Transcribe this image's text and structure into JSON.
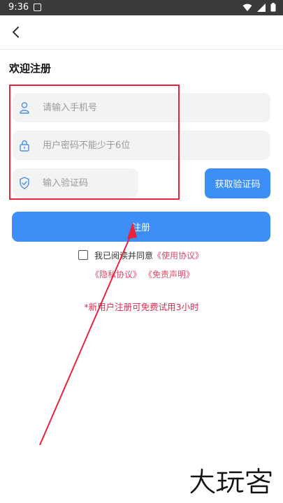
{
  "status_bar": {
    "time": "9:36"
  },
  "header": {
    "title": "欢迎注册"
  },
  "form": {
    "phone_placeholder": "请输入手机号",
    "password_placeholder": "用户密码不能少于6位",
    "code_placeholder": "输入验证码",
    "get_code_label": "获取验证码",
    "register_label": "注册"
  },
  "agreement": {
    "prefix": "我已阅读并同意",
    "terms_link": "《使用协议》",
    "privacy_link": "《隐私协议》",
    "disclaimer_link": "《免责声明》"
  },
  "promo_text": "*新用户注册可免费试用3小时",
  "watermark": "大玩客",
  "colors": {
    "accent": "#3d8ef7",
    "highlight": "#e8243a",
    "link": "#e04868",
    "promo": "#e02850"
  }
}
